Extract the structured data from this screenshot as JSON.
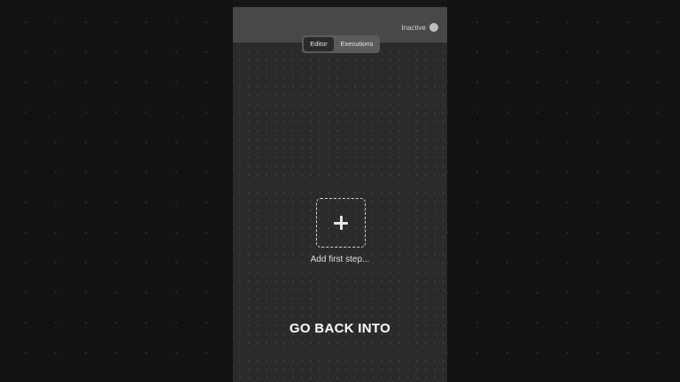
{
  "header": {
    "status_label": "Inactive"
  },
  "tabs": [
    {
      "label": "Editor",
      "active": true
    },
    {
      "label": "Executions",
      "active": false
    }
  ],
  "canvas": {
    "add_label": "Add first step...",
    "add_icon": "plus-icon"
  },
  "caption": {
    "text": "GO BACK INTO"
  },
  "colors": {
    "background": "#121212",
    "canvas": "#2b2b2b",
    "topbar": "#474849",
    "accent_text": "#ffffff"
  }
}
